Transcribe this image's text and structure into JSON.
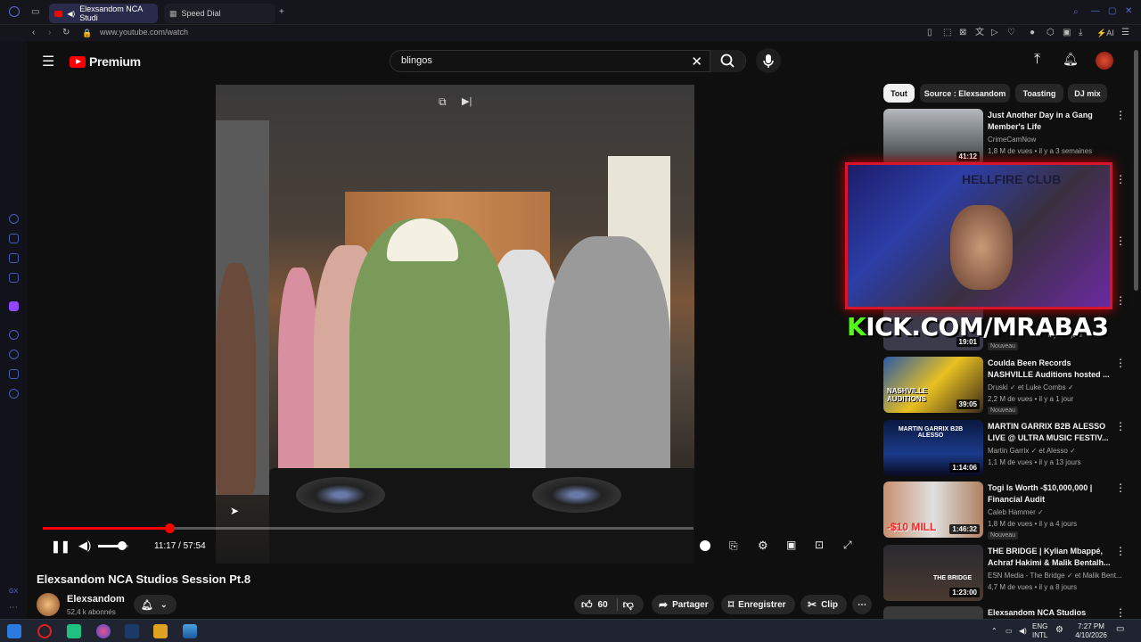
{
  "browser": {
    "tabs": [
      {
        "label": "Elexsandom NCA Studi"
      },
      {
        "label": "Speed Dial"
      }
    ],
    "url": "www.youtube.com/watch",
    "ai_label": "AI"
  },
  "header": {
    "logo_text": "Premium",
    "search_value": "blingos"
  },
  "video": {
    "title": "Elexsandom NCA Studios Session Pt.8",
    "time_display": "11:17 / 57:54",
    "progress": 0.195,
    "volume": 0.8,
    "channel": "Elexsandom",
    "subscribers": "52,4 k abonnés",
    "likes": "60",
    "actions": {
      "share": "Partager",
      "save": "Enregistrer",
      "clip": "Clip"
    }
  },
  "chips": [
    "Tout",
    "Source : Elexsandom",
    "Toasting",
    "DJ mix"
  ],
  "recommendations": [
    {
      "title": "Just Another Day in a Gang Member's Life",
      "channel": "CrimeCamNow",
      "meta": "1,8 M de vues • il y a 3 semaines",
      "duration": "41:12",
      "new": ""
    },
    {
      "title": "",
      "channel": "",
      "meta": "il y a 1 jour",
      "duration": "19:01",
      "new": "Nouveau"
    },
    {
      "title": "Coulda Been Records NASHVILLE Auditions hosted ...",
      "channel": "Druski",
      "channel2": "et Luke Combs",
      "meta": "2,2 M de vues • il y a 1 jour",
      "duration": "39:05",
      "new": "Nouveau",
      "thumb_text": "NASHVILLE AUDITIONS"
    },
    {
      "title": "MARTIN GARRIX B2B ALESSO LIVE @ ULTRA MUSIC FESTIV...",
      "channel": "Martin Garrix",
      "channel2": "et Alesso",
      "meta": "1,1 M de vues • il y a 13 jours",
      "duration": "1:14:06",
      "new": "",
      "thumb_text": "MARTIN GARRIX B2B ALESSO"
    },
    {
      "title": "Togi Is Worth -$10,000,000 | Financial Audit",
      "channel": "Caleb Hammer",
      "meta": "1,8 M de vues • il y a 4 jours",
      "duration": "1:46:32",
      "new": "Nouveau",
      "thumb_text": "-$10 MILL"
    },
    {
      "title": "THE BRIDGE | Kylian Mbappé, Achraf Hakimi & Malik Bentalh...",
      "channel": "ESN Media - The Bridge",
      "channel2": "et Malik Bent...",
      "meta": "4,7 M de vues • il y a 8 jours",
      "duration": "1:23:00",
      "new": "",
      "thumb_text": "THE BRIDGE"
    },
    {
      "title": "Elexsandom NCA Studios",
      "channel": "",
      "meta": "",
      "duration": "",
      "new": ""
    }
  ],
  "overlay": {
    "kick_text_k": "K",
    "kick_text_rest": "ICK.COM/MRABA3",
    "sign": "HELLFIRE CLUB"
  },
  "taskbar": {
    "lang": "ENG",
    "layout": "INTL",
    "time": "7:27 PM",
    "date": "4/10/2026"
  },
  "colors": {
    "accent": "#ff0000",
    "kick_green": "#53fc18",
    "background": "#0f0f0f"
  }
}
